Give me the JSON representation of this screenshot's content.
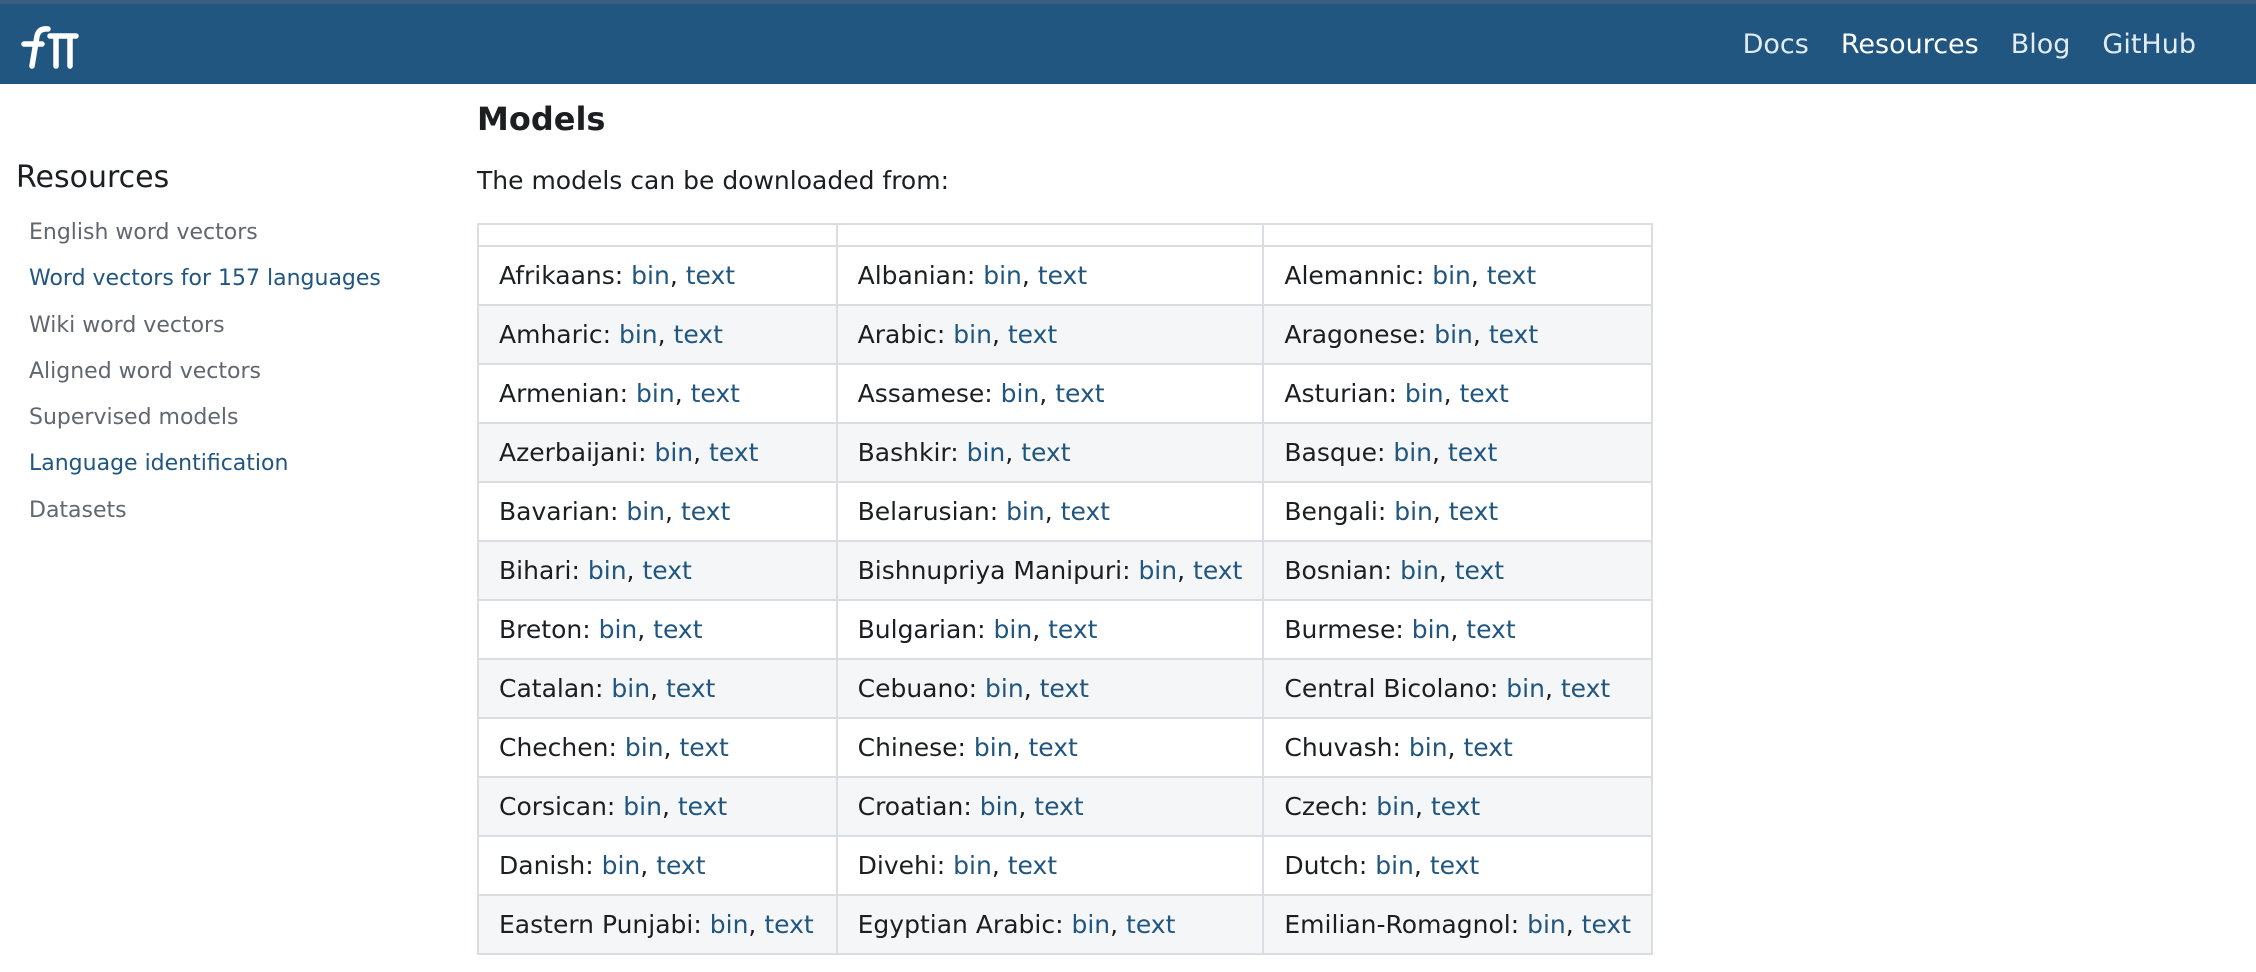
{
  "colors": {
    "header_bg": "#20567f",
    "link": "#20567f",
    "text": "#1c1e21",
    "muted": "#606770"
  },
  "header": {
    "logo_icon": "fasttext-logo-icon",
    "nav": [
      "Docs",
      "Resources",
      "Blog",
      "GitHub"
    ],
    "active_nav": "Resources"
  },
  "sidebar": {
    "title": "Resources",
    "items": [
      {
        "label": "English word vectors",
        "highlight": false
      },
      {
        "label": "Word vectors for 157 languages",
        "highlight": true
      },
      {
        "label": "Wiki word vectors",
        "highlight": false
      },
      {
        "label": "Aligned word vectors",
        "highlight": false
      },
      {
        "label": "Supervised models",
        "highlight": false
      },
      {
        "label": "Language identification",
        "highlight": true
      },
      {
        "label": "Datasets",
        "highlight": false
      }
    ]
  },
  "main": {
    "title": "Models",
    "intro": "The models can be downloaded from:",
    "link_bin": "bin",
    "link_text": "text",
    "rows": [
      [
        "Afrikaans",
        "Albanian",
        "Alemannic"
      ],
      [
        "Amharic",
        "Arabic",
        "Aragonese"
      ],
      [
        "Armenian",
        "Assamese",
        "Asturian"
      ],
      [
        "Azerbaijani",
        "Bashkir",
        "Basque"
      ],
      [
        "Bavarian",
        "Belarusian",
        "Bengali"
      ],
      [
        "Bihari",
        "Bishnupriya Manipuri",
        "Bosnian"
      ],
      [
        "Breton",
        "Bulgarian",
        "Burmese"
      ],
      [
        "Catalan",
        "Cebuano",
        "Central Bicolano"
      ],
      [
        "Chechen",
        "Chinese",
        "Chuvash"
      ],
      [
        "Corsican",
        "Croatian",
        "Czech"
      ],
      [
        "Danish",
        "Divehi",
        "Dutch"
      ],
      [
        "Eastern Punjabi",
        "Egyptian Arabic",
        "Emilian-Romagnol"
      ]
    ]
  }
}
